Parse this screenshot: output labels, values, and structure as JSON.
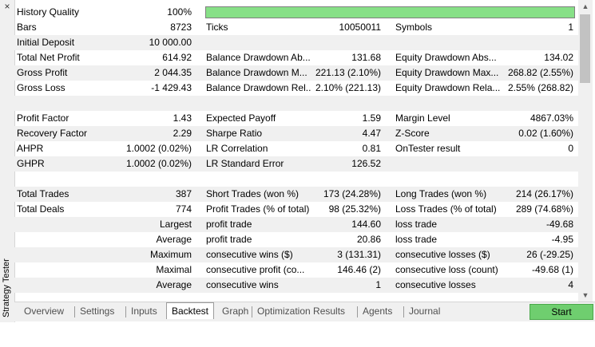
{
  "panel": {
    "title": "Strategy Tester",
    "close_glyph": "×"
  },
  "history_quality": {
    "label": "History Quality",
    "value": "100%",
    "fill_fraction": 1.0,
    "bar_color": "#87e087"
  },
  "rows": [
    {
      "l1": "Bars",
      "v1": "8723",
      "l2": "Ticks",
      "v2": "10050011",
      "l3": "Symbols",
      "v3": "1",
      "shade": false
    },
    {
      "l1": "Initial Deposit",
      "v1": "10 000.00",
      "l2": "",
      "v2": "",
      "l3": "",
      "v3": "",
      "shade": true
    },
    {
      "l1": "Total Net Profit",
      "v1": "614.92",
      "l2": "Balance Drawdown Ab...",
      "v2": "131.68",
      "l3": "Equity Drawdown Abs...",
      "v3": "134.02",
      "shade": false
    },
    {
      "l1": "Gross Profit",
      "v1": "2 044.35",
      "l2": "Balance Drawdown M...",
      "v2": "221.13 (2.10%)",
      "l3": "Equity Drawdown Max...",
      "v3": "268.82 (2.55%)",
      "shade": true
    },
    {
      "l1": "Gross Loss",
      "v1": "-1 429.43",
      "l2": "Balance Drawdown Rel...",
      "v2": "2.10% (221.13)",
      "l3": "Equity Drawdown Rela...",
      "v3": "2.55% (268.82)",
      "shade": false
    },
    {
      "l1": "",
      "v1": "",
      "l2": "",
      "v2": "",
      "l3": "",
      "v3": "",
      "shade": true
    },
    {
      "l1": "Profit Factor",
      "v1": "1.43",
      "l2": "Expected Payoff",
      "v2": "1.59",
      "l3": "Margin Level",
      "v3": "4867.03%",
      "shade": false
    },
    {
      "l1": "Recovery Factor",
      "v1": "2.29",
      "l2": "Sharpe Ratio",
      "v2": "4.47",
      "l3": "Z-Score",
      "v3": "0.02 (1.60%)",
      "shade": true
    },
    {
      "l1": "AHPR",
      "v1": "1.0002 (0.02%)",
      "l2": "LR Correlation",
      "v2": "0.81",
      "l3": "OnTester result",
      "v3": "0",
      "shade": false
    },
    {
      "l1": "GHPR",
      "v1": "1.0002 (0.02%)",
      "l2": "LR Standard Error",
      "v2": "126.52",
      "l3": "",
      "v3": "",
      "shade": true
    },
    {
      "l1": "",
      "v1": "",
      "l2": "",
      "v2": "",
      "l3": "",
      "v3": "",
      "shade": false
    },
    {
      "l1": "Total Trades",
      "v1": "387",
      "l2": "Short Trades (won %)",
      "v2": "173 (24.28%)",
      "l3": "Long Trades (won %)",
      "v3": "214 (26.17%)",
      "shade": true
    },
    {
      "l1": "Total Deals",
      "v1": "774",
      "l2": "Profit Trades (% of total)",
      "v2": "98 (25.32%)",
      "l3": "Loss Trades (% of total)",
      "v3": "289 (74.68%)",
      "shade": false
    },
    {
      "l1": "",
      "v1": "Largest",
      "l2": "profit trade",
      "v2": "144.60",
      "l3": "loss trade",
      "v3": "-49.68",
      "shade": true
    },
    {
      "l1": "",
      "v1": "Average",
      "l2": "profit trade",
      "v2": "20.86",
      "l3": "loss trade",
      "v3": "-4.95",
      "shade": false
    },
    {
      "l1": "",
      "v1": "Maximum",
      "l2": "consecutive wins ($)",
      "v2": "3 (131.31)",
      "l3": "consecutive losses ($)",
      "v3": "26 (-29.25)",
      "shade": true
    },
    {
      "l1": "",
      "v1": "Maximal",
      "l2": "consecutive profit (co...",
      "v2": "146.46 (2)",
      "l3": "consecutive loss (count)",
      "v3": "-49.68 (1)",
      "shade": false
    },
    {
      "l1": "",
      "v1": "Average",
      "l2": "consecutive wins",
      "v2": "1",
      "l3": "consecutive losses",
      "v3": "4",
      "shade": true
    }
  ],
  "tabs": [
    {
      "label": "Overview",
      "active": false
    },
    {
      "label": "Settings",
      "active": false
    },
    {
      "label": "Inputs",
      "active": false
    },
    {
      "label": "Backtest",
      "active": true
    },
    {
      "label": "Graph",
      "active": false
    },
    {
      "label": "Optimization Results",
      "active": false
    },
    {
      "label": "Agents",
      "active": false
    },
    {
      "label": "Journal",
      "active": false
    }
  ],
  "start_button": {
    "label": "Start",
    "color": "#6fce6f"
  },
  "scrollbar": {
    "up_glyph": "▲",
    "down_glyph": "▼"
  }
}
